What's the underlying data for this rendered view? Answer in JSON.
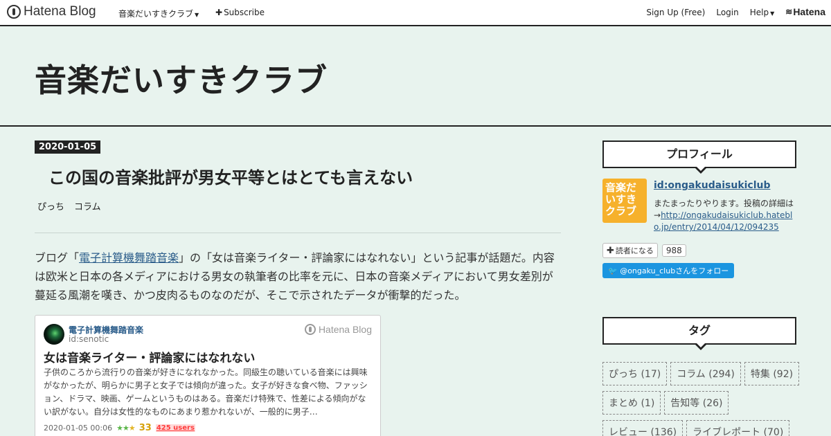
{
  "topbar": {
    "logo_text": "Hatena Blog",
    "blog_name": "音楽だいすきクラブ",
    "subscribe": "Subscribe",
    "signup": "Sign Up (Free)",
    "login": "Login",
    "help": "Help",
    "hatena": "Hatena"
  },
  "header": {
    "title": "音楽だいすきクラブ"
  },
  "entry": {
    "date": "2020-01-05",
    "title": "この国の音楽批評が男女平等とはとても言えない",
    "categories": [
      "ぴっち",
      "コラム"
    ],
    "body_pre": "ブログ「",
    "body_link": "電子計算機舞踏音楽",
    "body_post": "」の「女は音楽ライター・評論家にはなれない」という記事が話題だ。内容は欧米と日本の各メディアにおける男女の執筆者の比率を元に、日本の音楽メディアにおいて男女差別が蔓延る風潮を嘆き、かつ皮肉るものなのだが、そこで示されたデータが衝撃的だった。"
  },
  "card": {
    "blog_name": "電子計算機舞踏音楽",
    "user_id": "id:senotic",
    "brand": "Hatena Blog",
    "title": "女は音楽ライター・評論家にはなれない",
    "excerpt": "子供のころから流行りの音楽が好きになれなかった。同級生の聴いている音楽には興味がなかったが、明らかに男子と女子では傾向が違った。女子が好きな食べ物、ファッション、ドラマ、映画、ゲームというものはある。音楽だけ特殊で、性差による傾向がない訳がない。自分は女性的なものにあまり惹かれないが、一般的に男子…",
    "timestamp": "2020-01-05 00:06",
    "stars": "33",
    "users": "425 users"
  },
  "sidebar": {
    "profile_title": "プロフィール",
    "icon_text": "音楽だいすきクラブ",
    "user_id": "id:ongakudaisukiclub",
    "desc": "またまったりやります。投稿の詳細は→",
    "link": "http://ongakudaisukiclub.hateblo.jp/entry/2014/04/12/094235",
    "reader_label": "読者になる",
    "reader_count": "988",
    "follow": "@ongaku_clubさんをフォロー",
    "tags_title": "タグ",
    "tags": [
      "ぴっち (17)",
      "コラム (294)",
      "特集 (92)",
      "まとめ (1)",
      "告知等 (26)",
      "レビュー (136)",
      "ライブレポート (70)"
    ]
  },
  "colors": {
    "background": "#e8f3ee",
    "link": "#2a5c8a",
    "accent": "#f6b12c",
    "twitter": "#1b95e0"
  }
}
